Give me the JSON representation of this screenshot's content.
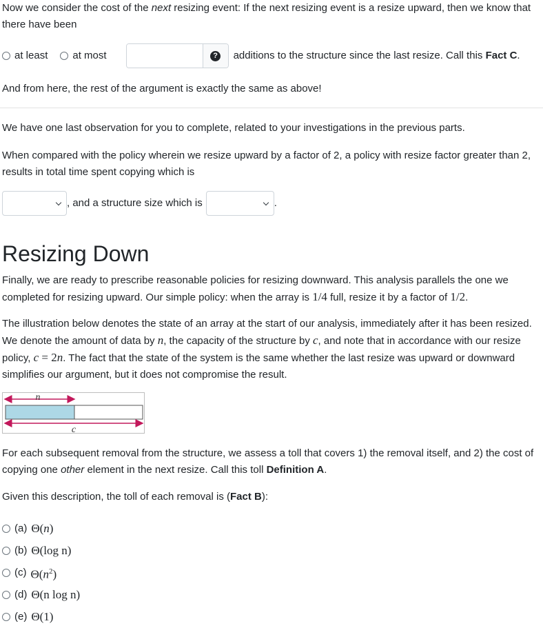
{
  "intro": {
    "line_pre": "Now we consider the cost of the ",
    "line_em": "next",
    "line_post": " resizing event: If the next resizing event is a resize upward, then we know that there have been"
  },
  "fact_c": {
    "option_at_least": "at least",
    "option_at_most": "at most",
    "input_value": "",
    "help_icon": "question-circle-icon",
    "help_glyph": "?",
    "suffix_pre": "additions to the structure since the last resize. Call this ",
    "suffix_bold": "Fact C",
    "suffix_post": "."
  },
  "rest_argument": "And from here, the rest of the argument is exactly the same as above!",
  "observation": {
    "intro": "We have one last observation for you to complete, related to your investigations in the previous parts.",
    "question": "When compared with the policy wherein we resize upward by a factor of 2, a policy with resize factor greater than 2, results in total time spent copying which is",
    "select1_value": "",
    "middle_text": ", and a structure size which is",
    "select2_value": "",
    "end_text": "."
  },
  "section": {
    "title": "Resizing Down",
    "para1_pre": "Finally, we are ready to prescribe reasonable policies for resizing downward. This analysis parallels the one we completed for resizing upward. Our simple policy: when the array is ",
    "para1_frac1": "1/4",
    "para1_mid": " full, resize it by a factor of ",
    "para1_frac2": "1/2",
    "para1_end": ".",
    "para2_a": "The illustration below denotes the state of an array at the start of our analysis, immediately after it has been resized. We denote the amount of data by ",
    "var_n": "n",
    "para2_b": ", the capacity of the structure by ",
    "var_c": "c",
    "para2_c": ", and note that in accordance with our resize policy, ",
    "eq_c": "c",
    "eq_eq": " = ",
    "eq_2": "2",
    "eq_n": "n",
    "para2_d": ". The fact that the state of the system is the same whether the last resize was upward or downward simplifies our argument, but it does not compromise the result."
  },
  "diagram": {
    "label_n": "n",
    "label_c": "c",
    "fill_fraction": 0.5,
    "fill_color": "#add8e6",
    "arrow_color": "#c2185b"
  },
  "definition": {
    "text_a": "For each subsequent removal from the structure, we assess a toll that covers 1) the removal itself, and 2) the cost of copying one ",
    "text_em": "other",
    "text_b": " element in the next resize. Call this toll ",
    "text_bold": "Definition A",
    "text_end": "."
  },
  "fact_b": {
    "pre": "Given this description, the toll of each removal is (",
    "bold": "Fact B",
    "post": "):"
  },
  "options": [
    {
      "label": "(a)",
      "theta": "Θ",
      "arg": "n",
      "sup": ""
    },
    {
      "label": "(b)",
      "theta": "Θ",
      "arg": "log n",
      "sup": ""
    },
    {
      "label": "(c)",
      "theta": "Θ",
      "arg": "n",
      "sup": "2"
    },
    {
      "label": "(d)",
      "theta": "Θ",
      "arg": "n log n",
      "sup": ""
    },
    {
      "label": "(e)",
      "theta": "Θ",
      "arg": "1",
      "sup": ""
    }
  ]
}
